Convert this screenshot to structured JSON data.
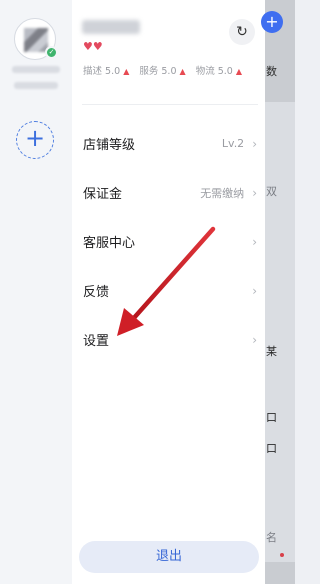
{
  "shop": {
    "hearts": "♥♥",
    "ratings": [
      {
        "label": "描述",
        "value": "5.0"
      },
      {
        "label": "服务",
        "value": "5.0"
      },
      {
        "label": "物流",
        "value": "5.0"
      }
    ]
  },
  "icons": {
    "refresh": "↻",
    "add_account": "+",
    "rating_arrow": "▲",
    "chevron": "›",
    "verified": "✓"
  },
  "menu": [
    {
      "label": "店铺等级",
      "value": "Lv.2"
    },
    {
      "label": "保证金",
      "value": "无需缴纳"
    },
    {
      "label": "客服中心",
      "value": ""
    },
    {
      "label": "反馈",
      "value": ""
    },
    {
      "label": "设置",
      "value": ""
    }
  ],
  "logout_label": "退出",
  "underlay": {
    "plus": "+",
    "texts": [
      "数",
      "双",
      "某",
      "口",
      "口",
      "名"
    ]
  },
  "colors": {
    "accent": "#3767d6",
    "arrow": "#d32027",
    "badge": "#3fb46d"
  }
}
